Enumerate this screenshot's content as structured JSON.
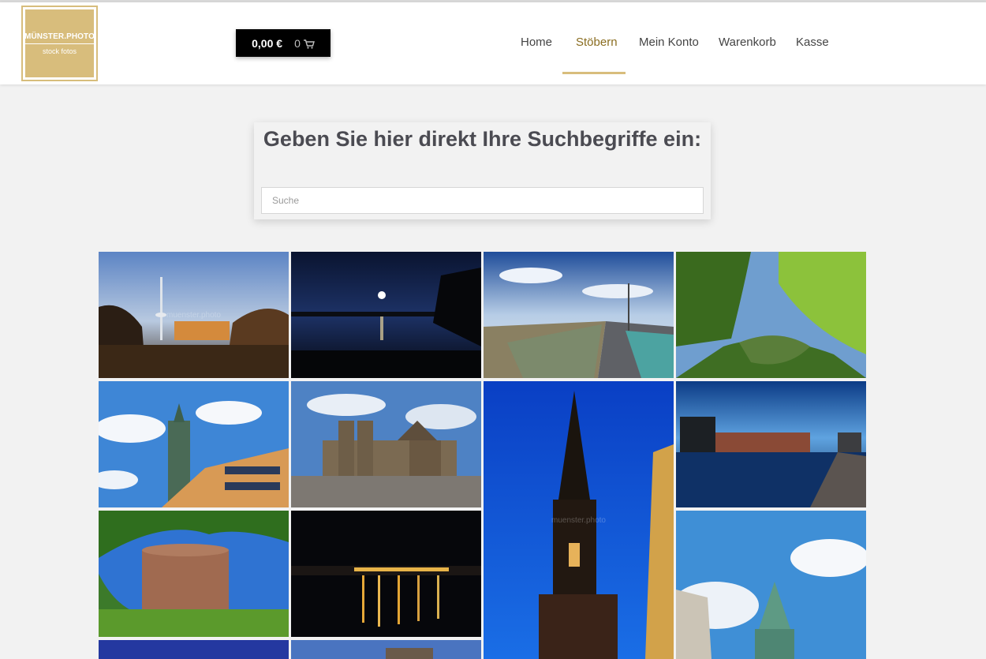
{
  "logo": {
    "title": "MÜNSTER.PHOTO",
    "subtitle": "stock fotos"
  },
  "cart": {
    "total": "0,00 €",
    "count": "0",
    "icon": "shopping-cart-icon"
  },
  "nav": {
    "items": [
      {
        "label": "Home",
        "active": false
      },
      {
        "label": "Stöbern",
        "active": true
      },
      {
        "label": "Mein Konto",
        "active": false
      },
      {
        "label": "Warenkorb",
        "active": false
      },
      {
        "label": "Kasse",
        "active": false
      }
    ]
  },
  "search": {
    "heading": "Geben Sie hier direkt Ihre Suchbegriffe ein:",
    "placeholder": "Suche"
  },
  "gallery": {
    "watermark": "muenster.photo",
    "photos": [
      {
        "name": "photo-fernmeldeturm-dusk"
      },
      {
        "name": "photo-lake-moon-night"
      },
      {
        "name": "photo-canal-lock"
      },
      {
        "name": "photo-green-canal"
      },
      {
        "name": "photo-tower-facade"
      },
      {
        "name": "photo-st-paulus-dom"
      },
      {
        "name": "photo-lamberti-church-tower"
      },
      {
        "name": "photo-harbour-reflection"
      },
      {
        "name": "photo-round-brick-tower"
      },
      {
        "name": "photo-night-lake-lights"
      },
      {
        "name": "photo-copper-tower-sky"
      },
      {
        "name": "photo-bottom-left"
      },
      {
        "name": "photo-bottom-middle"
      }
    ]
  },
  "colors": {
    "accent": "#d8bd7c",
    "nav_active": "#8a6d20",
    "page_bg": "#f2f2f2"
  }
}
